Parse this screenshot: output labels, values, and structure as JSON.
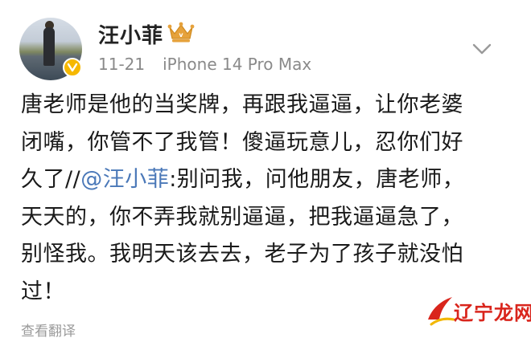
{
  "post": {
    "author": {
      "name": "汪小菲",
      "avatar_icon": "avatar-photo",
      "verified_icon": "verified-badge-icon",
      "badge_icon": "crown-icon"
    },
    "meta": {
      "date": "11-21",
      "device": "iPhone 14 Pro Max"
    },
    "menu_icon": "chevron-down-icon",
    "content": {
      "line1": "唐老师是他的当奖牌，再跟我逼逼，让你老婆",
      "line2": "闭嘴，你管不了我管！傻逼玩意儿，忍你们好",
      "line3_prefix": "久了//",
      "mention": "@汪小菲",
      "line3_suffix": ":别问我，问他朋友，唐老师，",
      "line4": "天天的，你不弄我就别逼逼，把我逼逼急了，",
      "line5": "别怪我。我明天该去去，老子为了孩子就没怕",
      "line6": "过！"
    },
    "translate_label": "查看翻译"
  },
  "watermark": {
    "text": "辽宁龙网"
  },
  "colors": {
    "mention": "#4a78b8",
    "meta": "#8a8a8a",
    "crown": "#e6a23c",
    "verified": "#f6b800",
    "watermark": "#d9251c"
  }
}
